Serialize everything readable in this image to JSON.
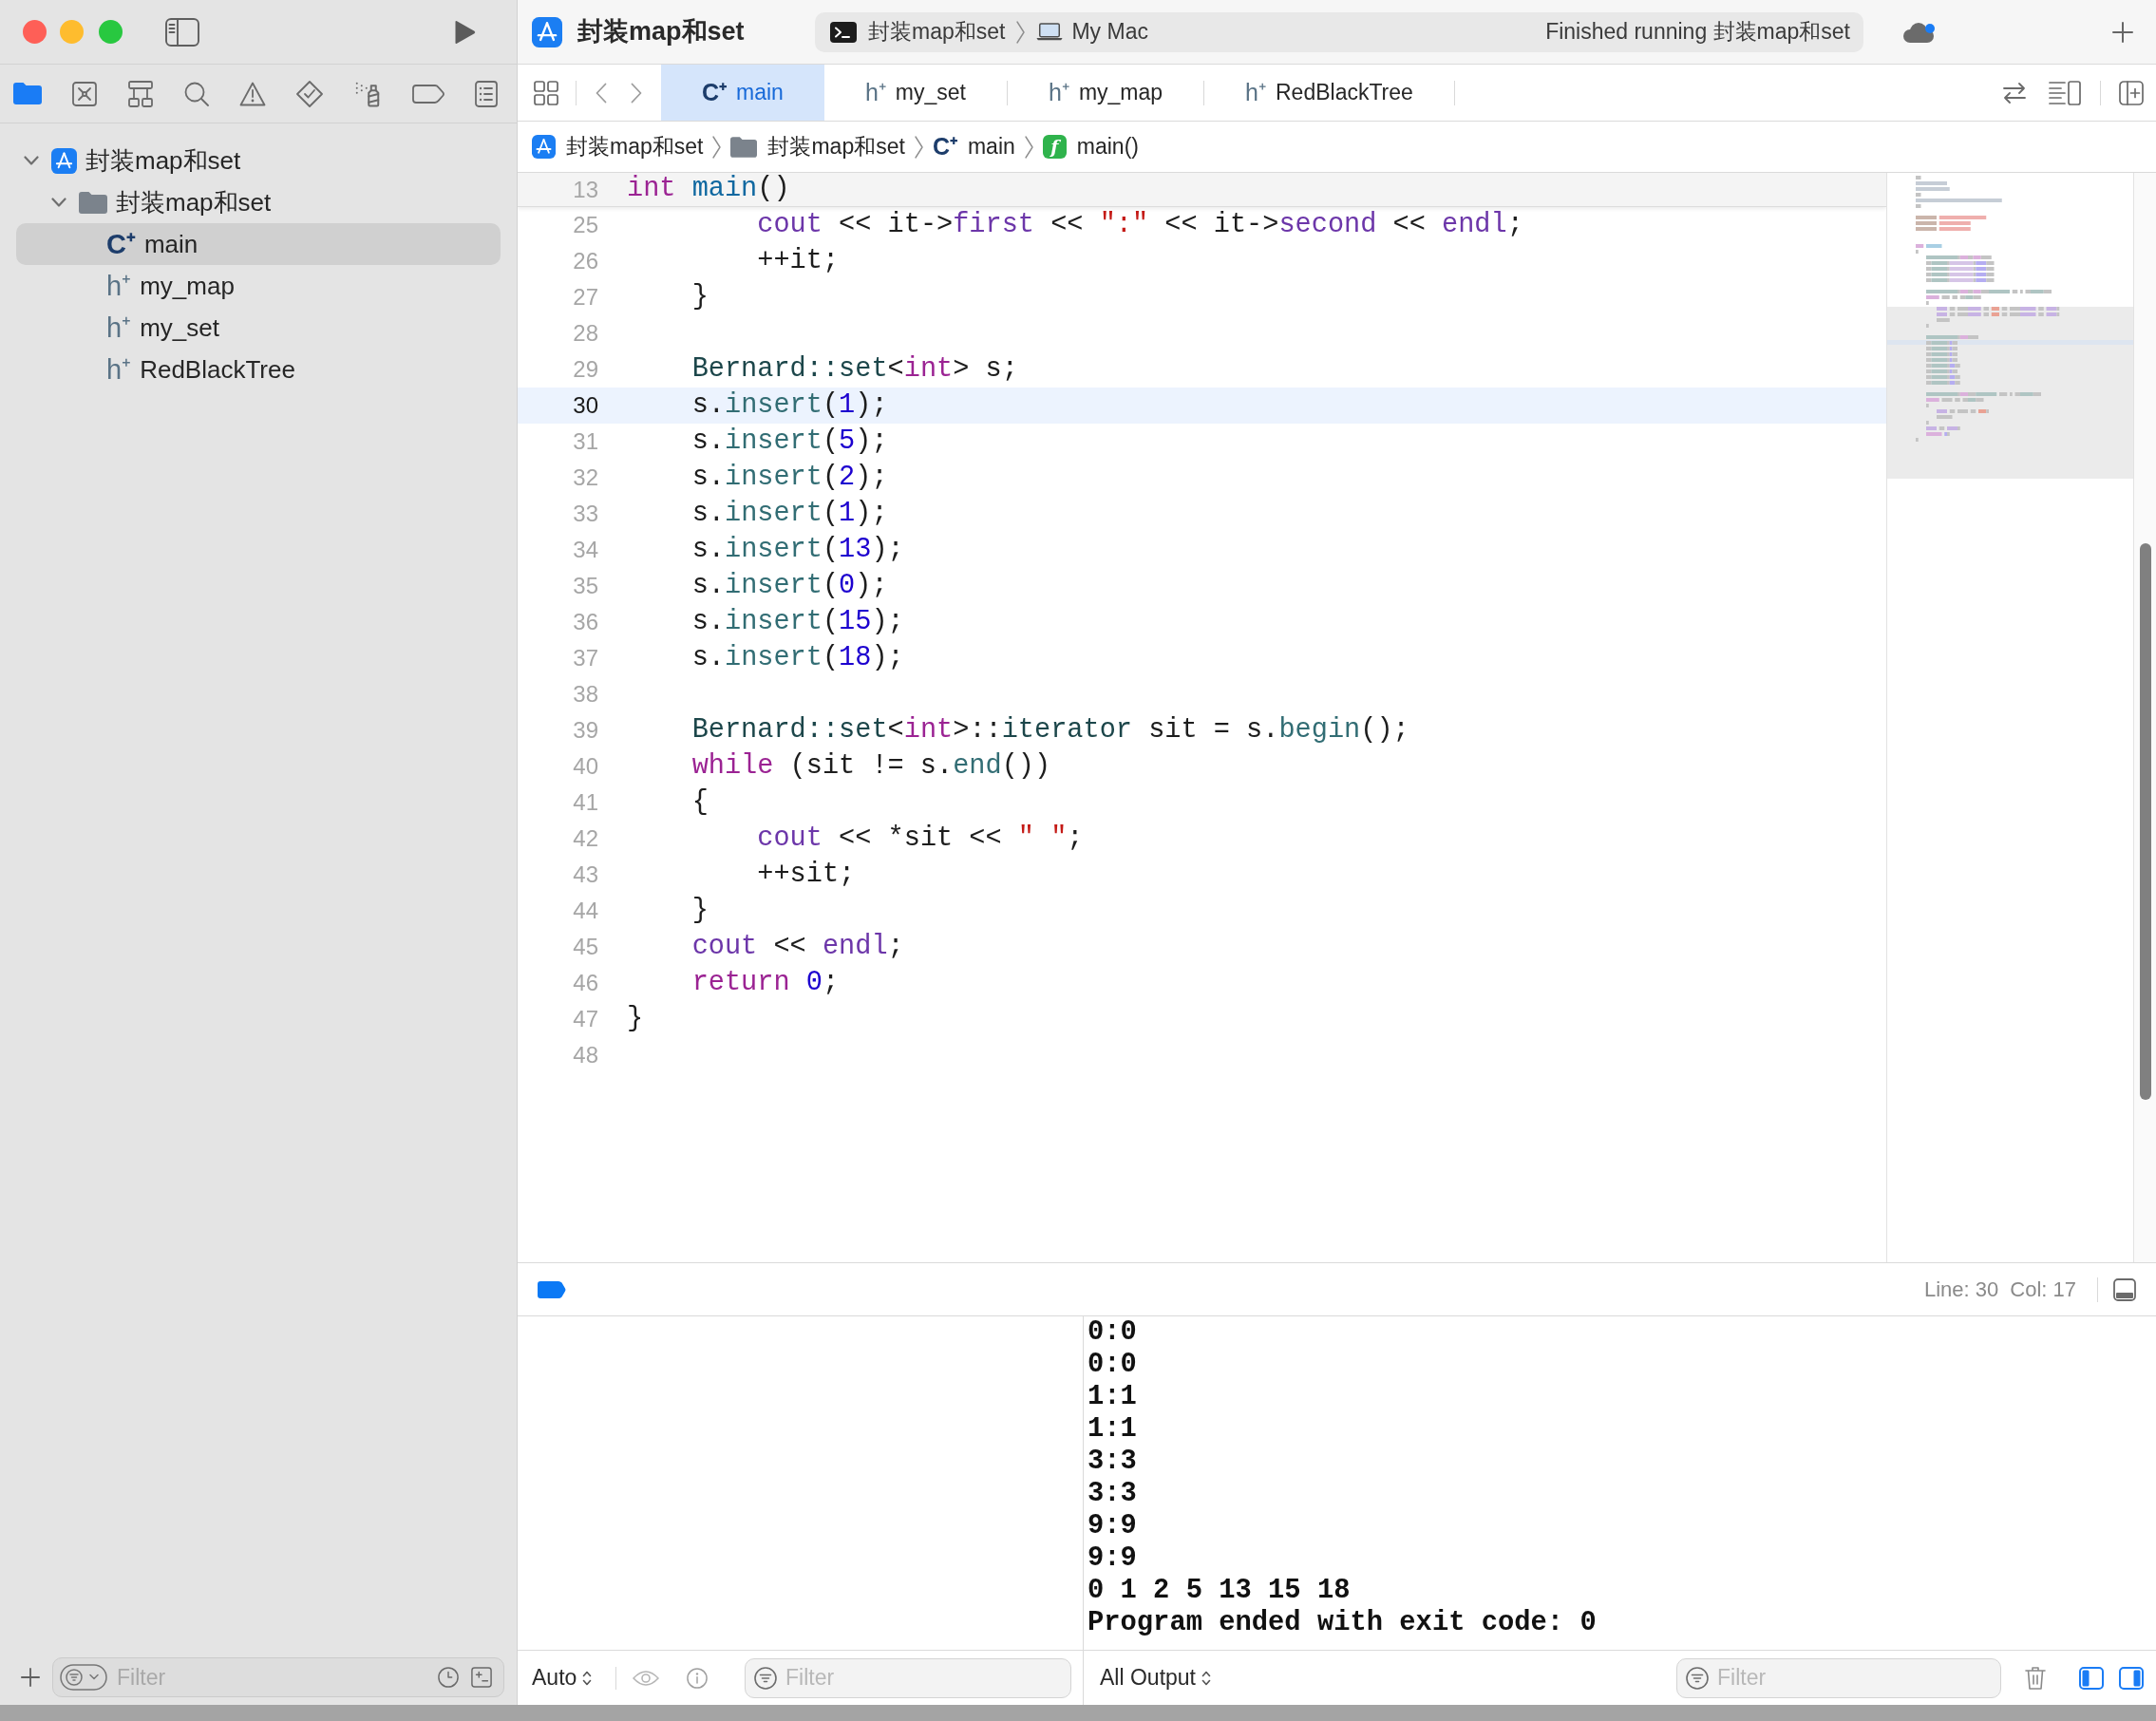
{
  "window": {
    "title": "封装map和set"
  },
  "activity": {
    "scheme": "封装map和set",
    "destination": "My Mac",
    "status": "Finished running 封装map和set"
  },
  "navigator_tabs": [
    {
      "kind": "project",
      "selected": true
    },
    {
      "kind": "sourcecontrol",
      "selected": false
    },
    {
      "kind": "symbols",
      "selected": false
    },
    {
      "kind": "find",
      "selected": false
    },
    {
      "kind": "issues",
      "selected": false
    },
    {
      "kind": "tests",
      "selected": false
    },
    {
      "kind": "debug",
      "selected": false
    },
    {
      "kind": "breakpoints",
      "selected": false
    },
    {
      "kind": "reports",
      "selected": false
    }
  ],
  "file_tree": [
    {
      "kind": "project",
      "name": "封装map和set",
      "expanded": true,
      "selected": false,
      "children": [
        {
          "kind": "folder",
          "name": "封装map和set",
          "expanded": true,
          "selected": false,
          "children": [
            {
              "kind": "source",
              "glyph": "C⁺",
              "name": "main",
              "selected": true
            },
            {
              "kind": "header",
              "glyph": "h⁺",
              "name": "my_map",
              "selected": false
            },
            {
              "kind": "header",
              "glyph": "h⁺",
              "name": "my_set",
              "selected": false
            },
            {
              "kind": "header",
              "glyph": "h⁺",
              "name": "RedBlackTree",
              "selected": false
            }
          ]
        }
      ]
    }
  ],
  "navigator_filter": {
    "placeholder": "Filter"
  },
  "editor_tabs": [
    {
      "kind": "source",
      "glyph": "C⁺",
      "name": "main",
      "selected": true
    },
    {
      "kind": "header",
      "glyph": "h⁺",
      "name": "my_set",
      "selected": false
    },
    {
      "kind": "header",
      "glyph": "h⁺",
      "name": "my_map",
      "selected": false
    },
    {
      "kind": "header",
      "glyph": "h⁺",
      "name": "RedBlackTree",
      "selected": false
    }
  ],
  "jump_bar": [
    {
      "kind": "project",
      "label": "封装map和set"
    },
    {
      "kind": "folder",
      "label": "封装map和set"
    },
    {
      "kind": "source",
      "glyph": "C⁺",
      "label": "main"
    },
    {
      "kind": "function",
      "glyph": "f",
      "label": "main()"
    }
  ],
  "editor": {
    "sticky_line": {
      "number": "13",
      "tokens": [
        {
          "kind": "keyword",
          "text": "int "
        },
        {
          "kind": "function",
          "text": "main"
        },
        {
          "kind": "plain",
          "text": "()"
        }
      ]
    },
    "lines": [
      {
        "number": "25",
        "current": false,
        "tokens": [
          {
            "kind": "library",
            "text": "        cout"
          },
          {
            "kind": "plain",
            "text": " << it->"
          },
          {
            "kind": "library",
            "text": "first"
          },
          {
            "kind": "plain",
            "text": " << "
          },
          {
            "kind": "string",
            "text": "\":\""
          },
          {
            "kind": "plain",
            "text": " << it->"
          },
          {
            "kind": "library",
            "text": "second"
          },
          {
            "kind": "plain",
            "text": " << "
          },
          {
            "kind": "library",
            "text": "endl"
          },
          {
            "kind": "plain",
            "text": ";"
          }
        ]
      },
      {
        "number": "26",
        "current": false,
        "tokens": [
          {
            "kind": "plain",
            "text": "        ++it;"
          }
        ]
      },
      {
        "number": "27",
        "current": false,
        "tokens": [
          {
            "kind": "plain",
            "text": "    }"
          }
        ]
      },
      {
        "number": "28",
        "current": false
      },
      {
        "number": "29",
        "current": false,
        "tokens": [
          {
            "kind": "type",
            "text": "    Bernard::set"
          },
          {
            "kind": "plain",
            "text": "<"
          },
          {
            "kind": "keyword",
            "text": "int"
          },
          {
            "kind": "plain",
            "text": "> s;"
          }
        ]
      },
      {
        "number": "30",
        "current": true,
        "tokens": [
          {
            "kind": "plain",
            "text": "    s."
          },
          {
            "kind": "method",
            "text": "insert"
          },
          {
            "kind": "plain",
            "text": "("
          },
          {
            "kind": "number",
            "text": "1"
          },
          {
            "kind": "plain",
            "text": ");"
          }
        ]
      },
      {
        "number": "31",
        "current": false,
        "tokens": [
          {
            "kind": "plain",
            "text": "    s."
          },
          {
            "kind": "method",
            "text": "insert"
          },
          {
            "kind": "plain",
            "text": "("
          },
          {
            "kind": "number",
            "text": "5"
          },
          {
            "kind": "plain",
            "text": ");"
          }
        ]
      },
      {
        "number": "32",
        "current": false,
        "tokens": [
          {
            "kind": "plain",
            "text": "    s."
          },
          {
            "kind": "method",
            "text": "insert"
          },
          {
            "kind": "plain",
            "text": "("
          },
          {
            "kind": "number",
            "text": "2"
          },
          {
            "kind": "plain",
            "text": ");"
          }
        ]
      },
      {
        "number": "33",
        "current": false,
        "tokens": [
          {
            "kind": "plain",
            "text": "    s."
          },
          {
            "kind": "method",
            "text": "insert"
          },
          {
            "kind": "plain",
            "text": "("
          },
          {
            "kind": "number",
            "text": "1"
          },
          {
            "kind": "plain",
            "text": ");"
          }
        ]
      },
      {
        "number": "34",
        "current": false,
        "tokens": [
          {
            "kind": "plain",
            "text": "    s."
          },
          {
            "kind": "method",
            "text": "insert"
          },
          {
            "kind": "plain",
            "text": "("
          },
          {
            "kind": "number",
            "text": "13"
          },
          {
            "kind": "plain",
            "text": ");"
          }
        ]
      },
      {
        "number": "35",
        "current": false,
        "tokens": [
          {
            "kind": "plain",
            "text": "    s."
          },
          {
            "kind": "method",
            "text": "insert"
          },
          {
            "kind": "plain",
            "text": "("
          },
          {
            "kind": "number",
            "text": "0"
          },
          {
            "kind": "plain",
            "text": ");"
          }
        ]
      },
      {
        "number": "36",
        "current": false,
        "tokens": [
          {
            "kind": "plain",
            "text": "    s."
          },
          {
            "kind": "method",
            "text": "insert"
          },
          {
            "kind": "plain",
            "text": "("
          },
          {
            "kind": "number",
            "text": "15"
          },
          {
            "kind": "plain",
            "text": ");"
          }
        ]
      },
      {
        "number": "37",
        "current": false,
        "tokens": [
          {
            "kind": "plain",
            "text": "    s."
          },
          {
            "kind": "method",
            "text": "insert"
          },
          {
            "kind": "plain",
            "text": "("
          },
          {
            "kind": "number",
            "text": "18"
          },
          {
            "kind": "plain",
            "text": ");"
          }
        ]
      },
      {
        "number": "38",
        "current": false
      },
      {
        "number": "39",
        "current": false,
        "tokens": [
          {
            "kind": "type",
            "text": "    Bernard::set"
          },
          {
            "kind": "plain",
            "text": "<"
          },
          {
            "kind": "keyword",
            "text": "int"
          },
          {
            "kind": "plain",
            "text": ">::"
          },
          {
            "kind": "type",
            "text": "iterator"
          },
          {
            "kind": "plain",
            "text": " sit = s."
          },
          {
            "kind": "method",
            "text": "begin"
          },
          {
            "kind": "plain",
            "text": "();"
          }
        ]
      },
      {
        "number": "40",
        "current": false,
        "tokens": [
          {
            "kind": "keyword",
            "text": "    while"
          },
          {
            "kind": "plain",
            "text": " (sit != s."
          },
          {
            "kind": "method",
            "text": "end"
          },
          {
            "kind": "plain",
            "text": "())"
          }
        ]
      },
      {
        "number": "41",
        "current": false,
        "tokens": [
          {
            "kind": "plain",
            "text": "    {"
          }
        ]
      },
      {
        "number": "42",
        "current": false,
        "tokens": [
          {
            "kind": "library",
            "text": "        cout"
          },
          {
            "kind": "plain",
            "text": " << *sit << "
          },
          {
            "kind": "string",
            "text": "\" \""
          },
          {
            "kind": "plain",
            "text": ";"
          }
        ]
      },
      {
        "number": "43",
        "current": false,
        "tokens": [
          {
            "kind": "plain",
            "text": "        ++sit;"
          }
        ]
      },
      {
        "number": "44",
        "current": false,
        "tokens": [
          {
            "kind": "plain",
            "text": "    }"
          }
        ]
      },
      {
        "number": "45",
        "current": false,
        "tokens": [
          {
            "kind": "library",
            "text": "    cout"
          },
          {
            "kind": "plain",
            "text": " << "
          },
          {
            "kind": "library",
            "text": "endl"
          },
          {
            "kind": "plain",
            "text": ";"
          }
        ]
      },
      {
        "number": "46",
        "current": false,
        "tokens": [
          {
            "kind": "keyword",
            "text": "    return "
          },
          {
            "kind": "number",
            "text": "0"
          },
          {
            "kind": "plain",
            "text": ";"
          }
        ]
      },
      {
        "number": "47",
        "current": false,
        "tokens": [
          {
            "kind": "plain",
            "text": "}"
          }
        ]
      },
      {
        "number": "48",
        "current": false
      }
    ]
  },
  "cursor": {
    "line": "Line: 30",
    "column": "Col: 17"
  },
  "variables": {
    "scope": "Auto",
    "filter": {
      "placeholder": "Filter"
    }
  },
  "console": {
    "output": [
      "0:0",
      "0:0",
      "1:1",
      "1:1",
      "3:3",
      "3:3",
      "9:9",
      "9:9",
      "0 1 2 5 13 15 18",
      "Program ended with exit code: 0"
    ],
    "scope": "All Output",
    "filter": {
      "placeholder": "Filter"
    }
  }
}
